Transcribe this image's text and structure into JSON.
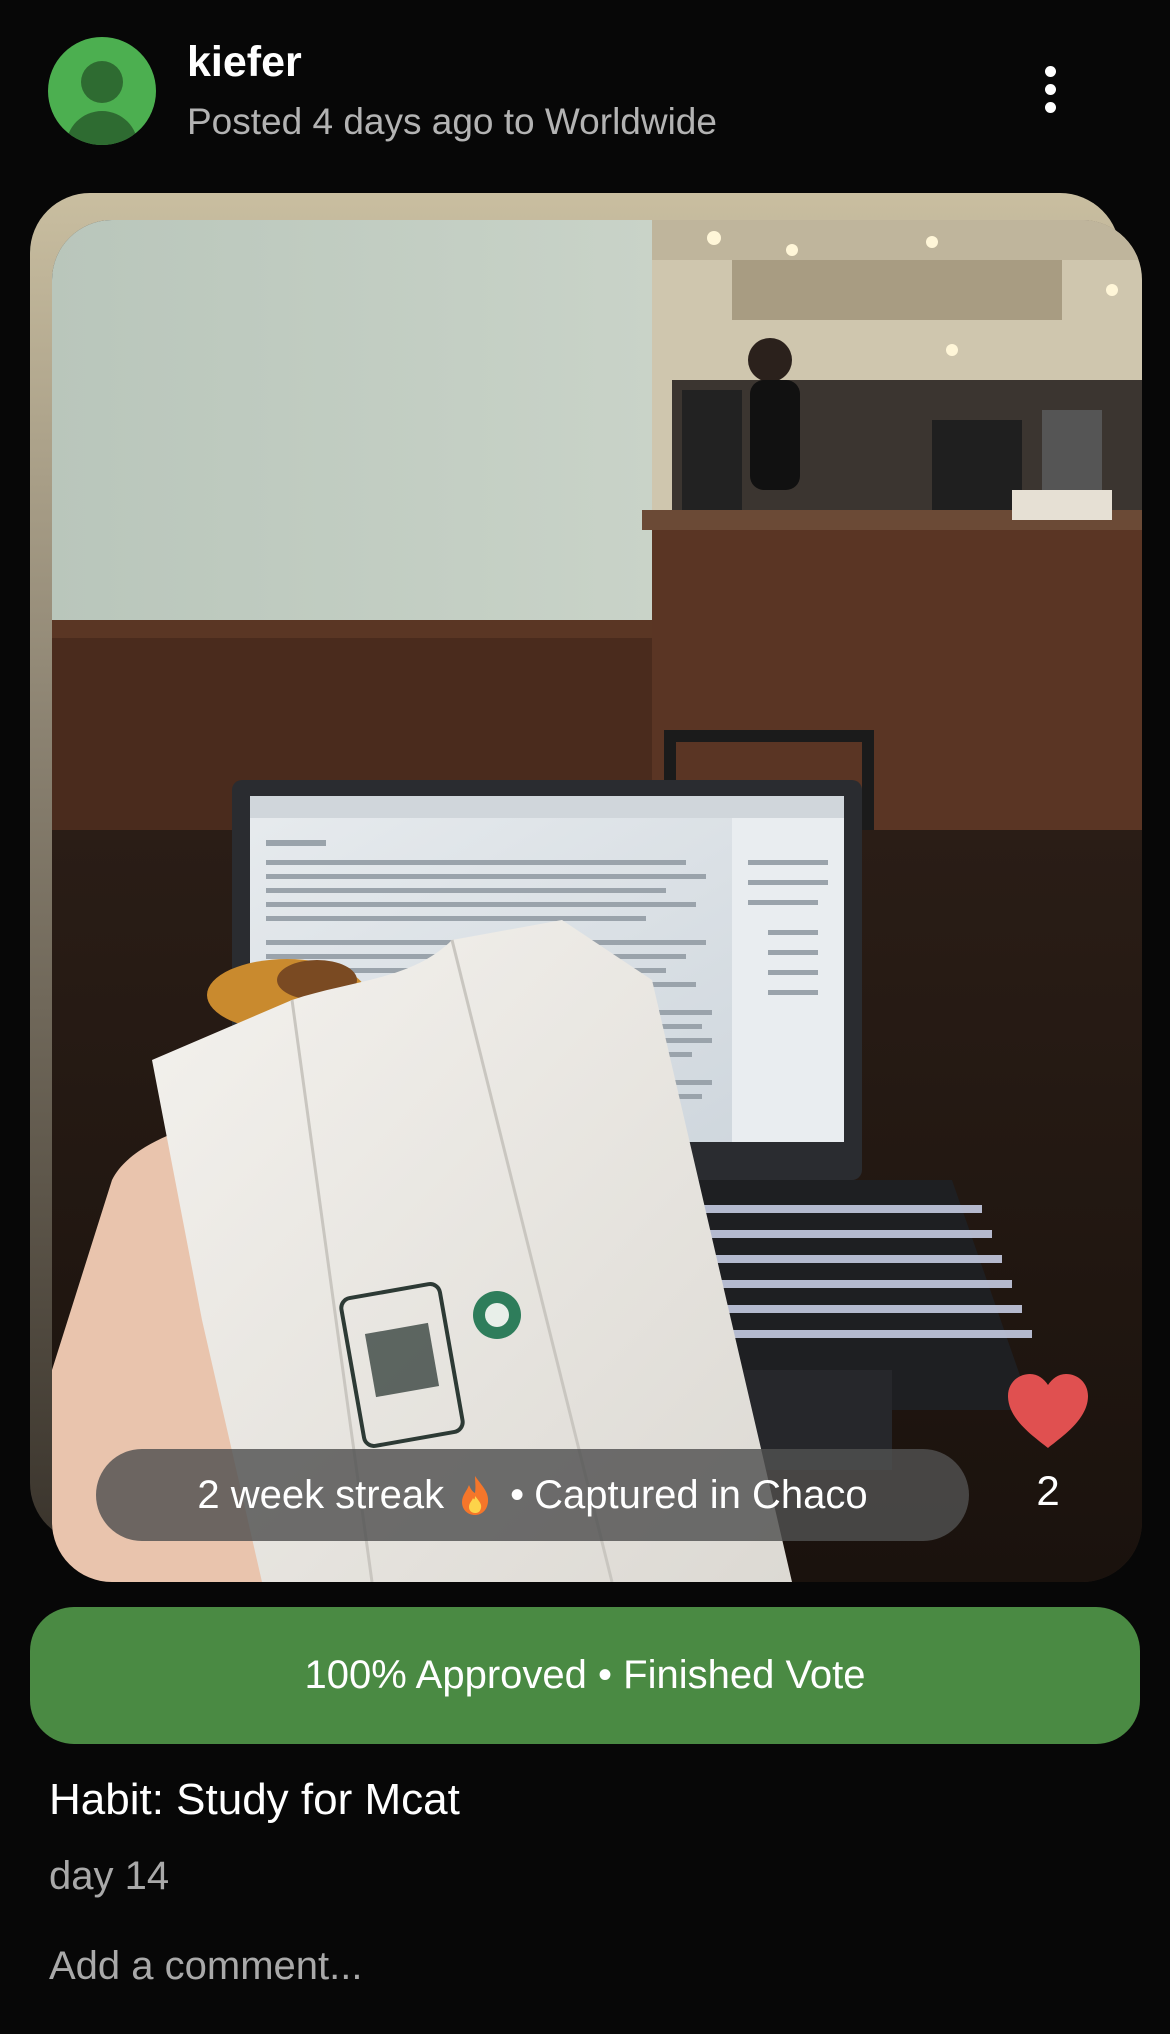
{
  "post": {
    "username": "kiefer",
    "meta": "Posted 4 days ago to Worldwide",
    "avatar_icon": "user-avatar-icon",
    "menu_icon": "more-vertical-icon"
  },
  "photo": {
    "streak_text": "2 week streak",
    "streak_icon": "fire-emoji",
    "separator": "•",
    "location_text": "Captured in Chaco",
    "like_count": "2",
    "like_icon": "heart-icon",
    "like_color": "#e05050"
  },
  "vote": {
    "label": "100% Approved • Finished Vote",
    "color": "#4a8a43"
  },
  "habit": {
    "title": "Habit: Study for Mcat",
    "day": "day 14"
  },
  "comment": {
    "placeholder": "Add a comment..."
  }
}
